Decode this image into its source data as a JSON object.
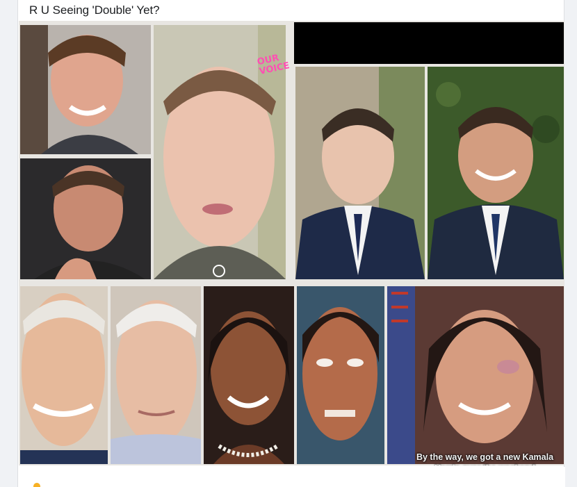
{
  "post": {
    "title": "R U Seeing 'Double' Yet?",
    "image": {
      "overlay_sticker": "OUR VOICE",
      "caption": "By the way, we got a new Kamala Harris over the weekend"
    }
  },
  "colors": {
    "feed_background": "#f0f2f5",
    "card_background": "#ffffff",
    "title_text": "#1c1e21",
    "reaction_yellow": "#f7b125"
  }
}
